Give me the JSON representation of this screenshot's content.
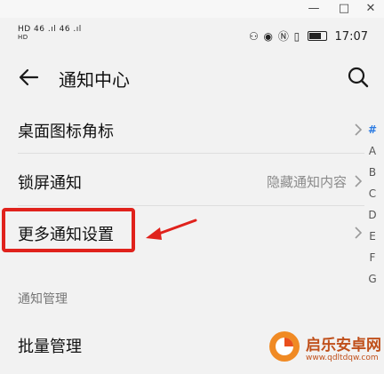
{
  "window": {
    "minimize_glyph": "—",
    "maximize_glyph": "□",
    "close_glyph": "✕"
  },
  "status_bar": {
    "left_line1": "HD 46 .ıl 46 .ıl",
    "left_line2": "HD",
    "right_icons": "⚇ ◉ Ⓝ ▯",
    "time": "17:07"
  },
  "header": {
    "title": "通知中心",
    "back_icon": "back-arrow-icon",
    "search_icon": "search-icon"
  },
  "list": {
    "items": [
      {
        "label": "桌面图标角标",
        "value": ""
      },
      {
        "label": "锁屏通知",
        "value": "隐藏通知内容"
      },
      {
        "label": "更多通知设置",
        "value": ""
      }
    ],
    "section_title": "通知管理",
    "batch_label": "批量管理"
  },
  "index_bar": [
    "#",
    "A",
    "B",
    "C",
    "D",
    "E",
    "F",
    "G"
  ],
  "annotation": {
    "highlight_color": "#e0221c"
  },
  "watermark": {
    "brand": "启乐安卓网",
    "url": "www.qdltdqw.com"
  }
}
